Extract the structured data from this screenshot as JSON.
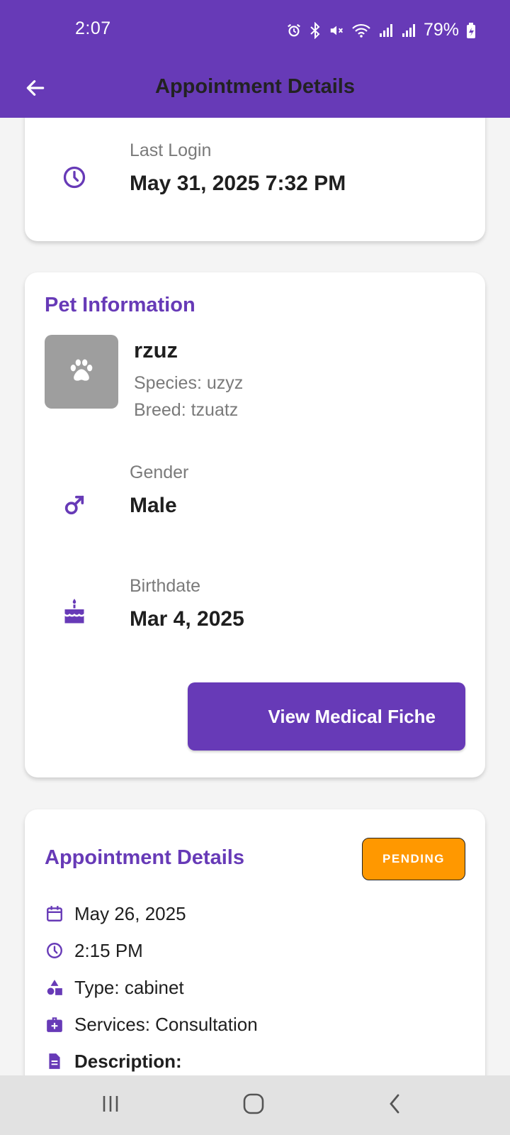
{
  "status_bar": {
    "time": "2:07",
    "battery_percent": "79%",
    "icons": [
      "alarm-icon",
      "bluetooth-icon",
      "mute-icon",
      "wifi-icon",
      "signal-icon",
      "signal-icon",
      "battery-charging-icon"
    ]
  },
  "app_bar": {
    "title": "Appointment Details",
    "back_icon": "arrow-back-icon"
  },
  "login_card": {
    "label": "Last Login",
    "value": "May 31, 2025 7:32 PM",
    "icon": "clock-icon"
  },
  "pet_card": {
    "title": "Pet Information",
    "avatar_icon": "paw-icon",
    "name": "rzuz",
    "species": "Species: uzyz",
    "breed": "Breed: tzuatz",
    "gender_label": "Gender",
    "gender_value": "Male",
    "birthdate_label": "Birthdate",
    "birthdate_value": "Mar 4, 2025",
    "medical_button": "View Medical Fiche"
  },
  "appointment_card": {
    "title": "Appointment Details",
    "status": "PENDING",
    "date": "May 26, 2025",
    "time": "2:15 PM",
    "type": "Type: cabinet",
    "services": "Services: Consultation",
    "description_label": "Description:"
  },
  "nav_bar": {
    "buttons": [
      "recent-apps-icon",
      "home-icon",
      "back-icon"
    ]
  },
  "colors": {
    "primary": "#673ab7",
    "status_pending": "#ff9800",
    "avatar_bg": "#9e9e9e",
    "background": "#f4f4f4"
  }
}
